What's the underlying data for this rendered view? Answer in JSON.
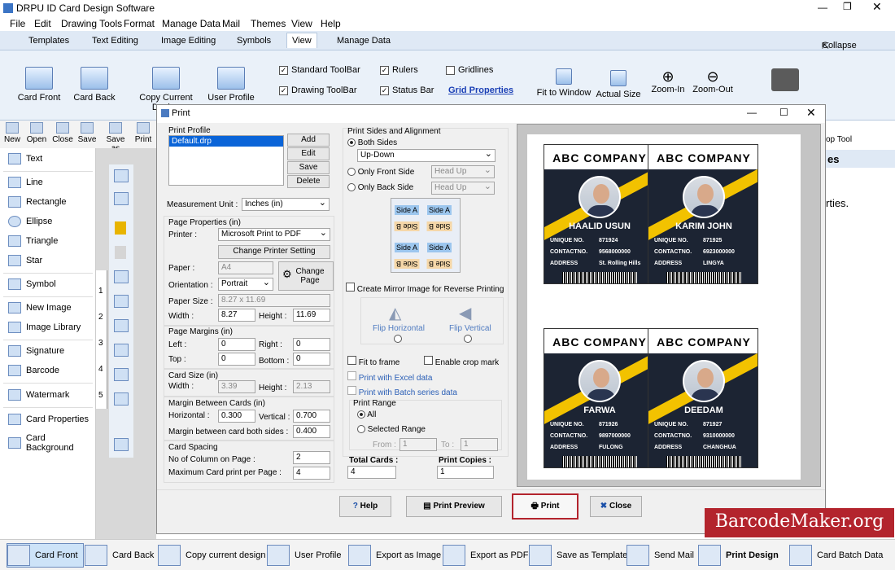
{
  "window": {
    "title": "DRPU ID Card Design Software"
  },
  "menu": [
    "File",
    "Edit",
    "Drawing Tools",
    "Format",
    "Manage Data",
    "Mail",
    "Themes",
    "View",
    "Help"
  ],
  "tabs": [
    "Templates",
    "Text Editing",
    "Image Editing",
    "Symbols",
    "View",
    "Manage Data"
  ],
  "collapse": "Collapse",
  "ribbon": {
    "buttons": [
      "Card Front",
      "Card Back",
      "Copy Current Design",
      "User Profile"
    ],
    "checks": [
      {
        "label": "Standard ToolBar",
        "checked": true
      },
      {
        "label": "Drawing ToolBar",
        "checked": true
      },
      {
        "label": "Rulers",
        "checked": true
      },
      {
        "label": "Status Bar",
        "checked": true
      },
      {
        "label": "Gridlines",
        "checked": false
      }
    ],
    "grid_link": "Grid Properties",
    "view": [
      "Fit to Window",
      "Actual Size",
      "Zoom-In",
      "Zoom-Out"
    ]
  },
  "toolbar": [
    "New",
    "Open",
    "Close",
    "Save",
    "Save as",
    "Print"
  ],
  "right_toolbar": "op Tool",
  "right_panel": {
    "header": "es",
    "text": "rties."
  },
  "left_panel": [
    "Text",
    "Line",
    "Rectangle",
    "Ellipse",
    "Triangle",
    "Star",
    "Symbol",
    "New Image",
    "Image Library",
    "Signature",
    "Barcode",
    "Watermark",
    "Card Properties",
    "Card Background"
  ],
  "ruler": [
    "1",
    "2",
    "3",
    "4",
    "5"
  ],
  "dialog": {
    "title": "Print",
    "print_profile": {
      "label": "Print Profile",
      "item": "Default.drp",
      "buttons": [
        "Add",
        "Edit",
        "Save",
        "Delete"
      ]
    },
    "measurement": {
      "label": "Measurement Unit :",
      "value": "Inches (in)"
    },
    "page_props": {
      "label": "Page Properties (in)",
      "printer_label": "Printer :",
      "printer": "Microsoft Print to PDF",
      "change_printer": "Change Printer Setting",
      "paper_label": "Paper :",
      "paper": "A4",
      "orientation_label": "Orientation :",
      "orientation": "Portrait",
      "change_page": "Change Page",
      "paper_size_label": "Paper Size :",
      "paper_size": "8.27 x 11.69",
      "width_label": "Width :",
      "width": "8.27",
      "height_label": "Height :",
      "height": "11.69"
    },
    "margins": {
      "label": "Page Margins (in)",
      "left_label": "Left :",
      "left": "0",
      "right_label": "Right :",
      "right": "0",
      "top_label": "Top :",
      "top": "0",
      "bottom_label": "Bottom :",
      "bottom": "0"
    },
    "card_size": {
      "label": "Card Size (in)",
      "width_label": "Width :",
      "width": "3.39",
      "height_label": "Height :",
      "height": "2.13"
    },
    "margin_between": {
      "label": "Margin Between Cards (in)",
      "h_label": "Horizontal :",
      "h": "0.300",
      "v_label": "Vertical :",
      "v": "0.700",
      "both_label": "Margin between card both sides :",
      "both": "0.400"
    },
    "spacing": {
      "label": "Card Spacing",
      "cols_label": "No of Column on Page :",
      "cols": "2",
      "max_label": "Maximum Card print per Page :",
      "max": "4"
    },
    "sides": {
      "label": "Print Sides and Alignment",
      "both": "Both Sides",
      "both_value": "Up-Down",
      "front": "Only Front Side",
      "front_value": "Head Up",
      "back": "Only Back Side",
      "back_value": "Head Up",
      "side_a": "Side A",
      "side_b": "Side B"
    },
    "mirror": "Create Mirror Image for Reverse Printing",
    "flip_h": "Flip Horizontal",
    "flip_v": "Flip Vertical",
    "fit_frame": "Fit to frame",
    "crop_mark": "Enable crop mark",
    "excel": "Print with Excel data",
    "batch": "Print with Batch series data",
    "range": {
      "label": "Print Range",
      "all": "All",
      "selected": "Selected Range",
      "from": "From :",
      "from_val": "1",
      "to": "To :",
      "to_val": "1"
    },
    "total_cards_label": "Total Cards :",
    "total_cards": "4",
    "copies_label": "Print Copies :",
    "copies": "1",
    "buttons": {
      "help": "Help",
      "preview": "Print Preview",
      "print": "Print",
      "close": "Close"
    }
  },
  "cards": [
    {
      "company": "ABC COMPANY",
      "name": "HAALID USUN",
      "unique": "871924",
      "contact": "9568000000",
      "address": "St. Rolling Hills"
    },
    {
      "company": "ABC COMPANY",
      "name": "KARIM JOHN",
      "unique": "871925",
      "contact": "6923000000",
      "address": "LINGYA"
    },
    {
      "company": "ABC COMPANY",
      "name": "FARWA",
      "unique": "871926",
      "contact": "9897000000",
      "address": "FULONG"
    },
    {
      "company": "ABC COMPANY",
      "name": "DEEDAM",
      "unique": "871927",
      "contact": "9310000000",
      "address": "CHANGHUA"
    }
  ],
  "card_labels": {
    "unique": "UNIQUE NO.",
    "contact": "CONTACTNO.",
    "address": "ADDRESS"
  },
  "footer": [
    "Card Front",
    "Card Back",
    "Copy current design",
    "User Profile",
    "Export as Image",
    "Export as PDF",
    "Save as Template",
    "Send Mail",
    "Print Design",
    "Card Batch Data"
  ],
  "watermark": "BarcodeMaker.org"
}
